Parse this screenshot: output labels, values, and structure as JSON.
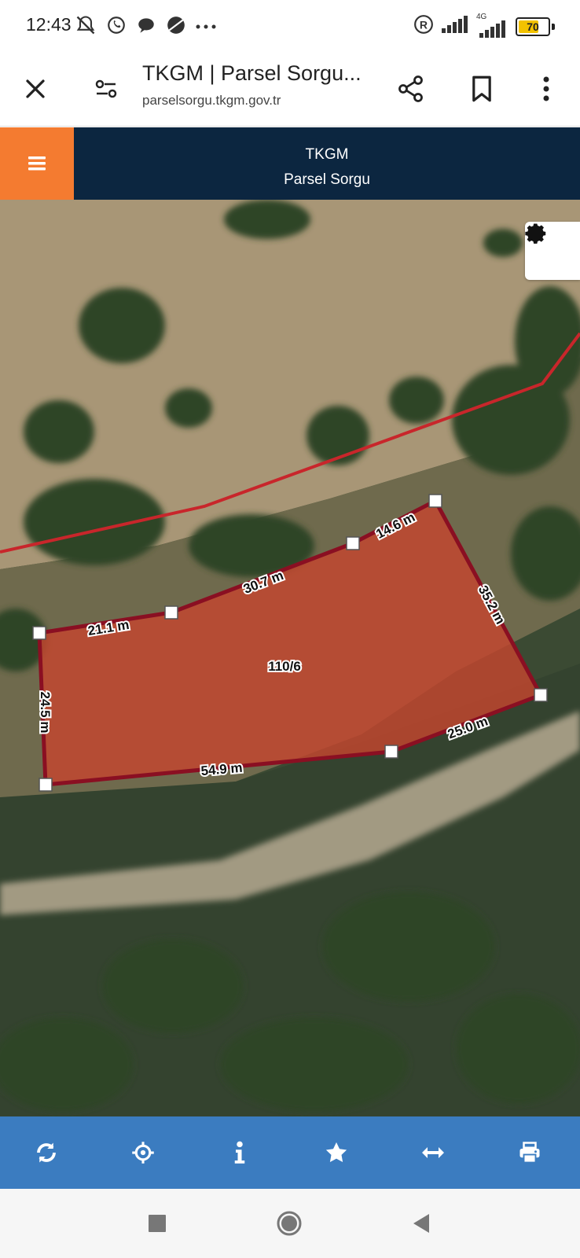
{
  "status_bar": {
    "time": "12:43",
    "network": "4G",
    "battery_percent": 70,
    "battery_label": "70"
  },
  "browser": {
    "title": "TKGM | Parsel Sorgu...",
    "url": "parselsorgu.tkgm.gov.tr"
  },
  "app_header": {
    "title": "TKGM",
    "subtitle": "Parsel Sorgu"
  },
  "map": {
    "parcel_label": "110/6",
    "measurements": [
      "21.1 m",
      "30.7 m",
      "14.6 m",
      "35.2 m",
      "25.0 m",
      "54.9 m",
      "24.5 m"
    ],
    "colors": {
      "parcel_fill": "#c4452e",
      "parcel_border": "#8a0f22",
      "boundary_line": "#c8262b"
    }
  },
  "bottom_toolbar": {
    "items": [
      "refresh-icon",
      "locate-icon",
      "info-icon",
      "star-icon",
      "measure-icon",
      "print-icon"
    ]
  },
  "colors": {
    "header_bg": "#0c2640",
    "menu_accent": "#f47b30",
    "toolbar_bg": "#3b7cc0"
  }
}
